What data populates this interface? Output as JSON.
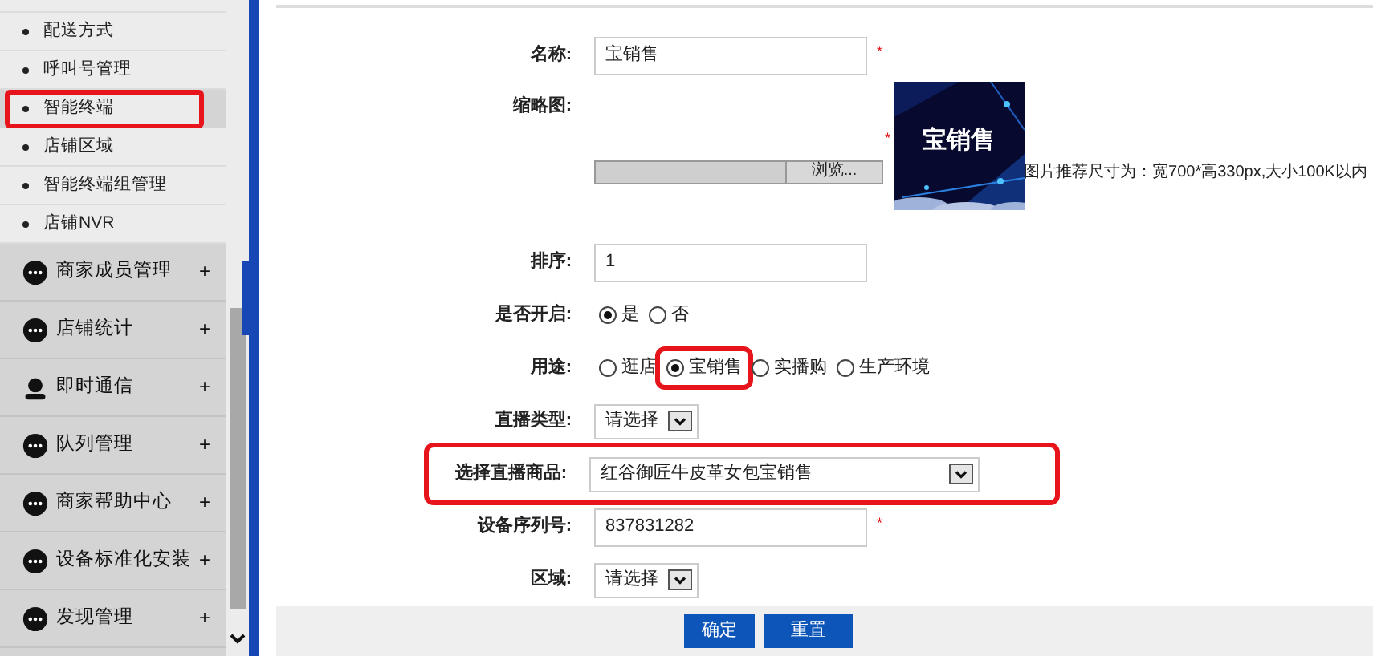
{
  "sidebar": {
    "sub_items": [
      {
        "label": "配送方式",
        "highlighted": false
      },
      {
        "label": "呼叫号管理",
        "highlighted": false
      },
      {
        "label": "智能终端",
        "highlighted": true
      },
      {
        "label": "店铺区域",
        "highlighted": false
      },
      {
        "label": "智能终端组管理",
        "highlighted": false
      },
      {
        "label": "店铺NVR",
        "highlighted": false
      }
    ],
    "groups": [
      {
        "label": "商家成员管理",
        "kind": "dots",
        "toggle": "+"
      },
      {
        "label": "店铺统计",
        "kind": "dots",
        "toggle": "+"
      },
      {
        "label": "即时通信",
        "kind": "person",
        "toggle": "+"
      },
      {
        "label": "队列管理",
        "kind": "dots",
        "toggle": "+"
      },
      {
        "label": "商家帮助中心",
        "kind": "dots",
        "toggle": "+"
      },
      {
        "label": "设备标准化安装",
        "kind": "dots",
        "toggle": "+"
      },
      {
        "label": "发现管理",
        "kind": "dots",
        "toggle": "+"
      }
    ]
  },
  "form": {
    "fields": [
      {
        "kind": "text",
        "label": "名称:",
        "value": "宝销售",
        "required_mark": "*",
        "highlighted": false
      },
      {
        "label": "缩略图:",
        "button": "浏览...",
        "required_mark": "*",
        "picture_text": "宝销售",
        "hint": "图片推荐尺寸为：宽700*高330px,大小100K以内",
        "highlighted": false
      },
      {
        "kind": "text",
        "label": "排序:",
        "value": "1",
        "highlighted": false
      },
      {
        "kind": "radio",
        "label": "是否开启:",
        "options": [
          {
            "label": "是",
            "selected": true,
            "highlighted": false
          },
          {
            "label": "否",
            "selected": false,
            "highlighted": false
          }
        ],
        "highlighted": false
      },
      {
        "kind": "radio",
        "label": "用途:",
        "options": [
          {
            "label": "逛店",
            "selected": false,
            "highlighted": false
          },
          {
            "label": "宝销售",
            "selected": true,
            "highlighted": true
          },
          {
            "label": "实播购",
            "selected": false,
            "highlighted": false
          },
          {
            "label": "生产环境",
            "selected": false,
            "highlighted": false
          }
        ],
        "highlighted": false
      },
      {
        "kind": "select",
        "label": "直播类型:",
        "value": "请选择",
        "wide": false,
        "highlighted": false
      },
      {
        "kind": "select",
        "label": "选择直播商品:",
        "value": "红谷御匠牛皮革女包宝销售",
        "wide": true,
        "highlighted": true
      },
      {
        "kind": "text",
        "label": "设备序列号:",
        "value": "837831282",
        "required_mark": "*",
        "highlighted": false
      },
      {
        "kind": "select",
        "label": "区域:",
        "value": "请选择",
        "wide": false,
        "highlighted": false
      }
    ],
    "buttons": [
      "确定",
      "重置"
    ]
  }
}
